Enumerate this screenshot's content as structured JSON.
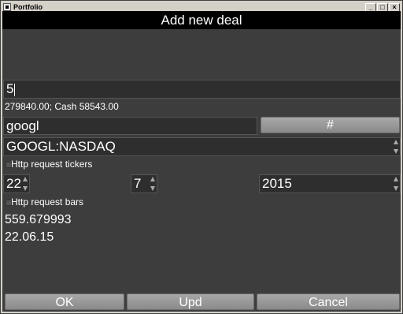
{
  "window": {
    "title": "Portfolio",
    "min_glyph": "_",
    "max_glyph": "□",
    "close_glyph": "×"
  },
  "header": {
    "title": "Add new deal"
  },
  "form": {
    "quantity_value": "5",
    "balance_text": "279840.00; Cash 58543.00",
    "search_value": "googl",
    "hash_button_label": "#",
    "ticker_selected": "GOOGL:NASDAQ",
    "http_tickers_label": "Http request tickers",
    "day_value": "22",
    "month_value": "7",
    "year_value": "2015",
    "http_bars_label": "Http request bars",
    "price_text": "559.679993",
    "date_text": "22.06.15"
  },
  "footer": {
    "ok_label": "OK",
    "upd_label": "Upd",
    "cancel_label": "Cancel"
  }
}
